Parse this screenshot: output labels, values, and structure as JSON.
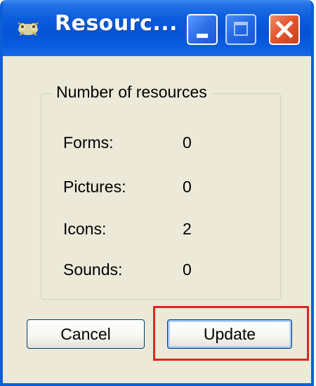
{
  "window": {
    "title": "Resourc...",
    "icons": {
      "app": "cat-app-icon",
      "minimize": "minimize-icon",
      "maximize": "maximize-icon",
      "close": "close-icon"
    },
    "colors": {
      "titlebar": "#0653d6",
      "close_button": "#e2532e",
      "highlight": "#e0261c"
    }
  },
  "group": {
    "legend": "Number of resources",
    "rows": [
      {
        "label": "Forms:",
        "value": "0"
      },
      {
        "label": "Pictures:",
        "value": "0"
      },
      {
        "label": "Icons:",
        "value": "2"
      },
      {
        "label": "Sounds:",
        "value": "0"
      }
    ]
  },
  "buttons": {
    "cancel": "Cancel",
    "update": "Update"
  }
}
